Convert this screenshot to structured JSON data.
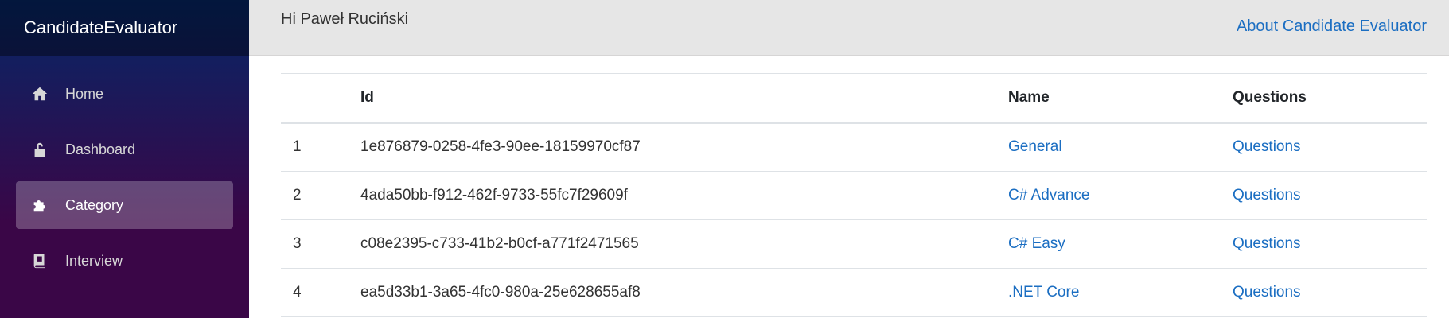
{
  "sidebar": {
    "brand": "CandidateEvaluator",
    "items": [
      {
        "label": "Home",
        "icon": "home-icon"
      },
      {
        "label": "Dashboard",
        "icon": "lock-open-icon"
      },
      {
        "label": "Category",
        "icon": "puzzle-icon"
      },
      {
        "label": "Interview",
        "icon": "book-icon"
      }
    ],
    "active": "Category"
  },
  "topbar": {
    "greeting": "Hi Paweł Ruciński",
    "about_link": "About Candidate Evaluator"
  },
  "table": {
    "headers": {
      "num": "",
      "id": "Id",
      "name": "Name",
      "questions": "Questions"
    },
    "rows": [
      {
        "num": "1",
        "id": "1e876879-0258-4fe3-90ee-18159970cf87",
        "name": "General",
        "questions": "Questions"
      },
      {
        "num": "2",
        "id": "4ada50bb-f912-462f-9733-55fc7f29609f",
        "name": "C# Advance",
        "questions": "Questions"
      },
      {
        "num": "3",
        "id": "c08e2395-c733-41b2-b0cf-a771f2471565",
        "name": "C# Easy",
        "questions": "Questions"
      },
      {
        "num": "4",
        "id": "ea5d33b1-3a65-4fc0-980a-25e628655af8",
        "name": ".NET Core",
        "questions": "Questions"
      }
    ]
  },
  "colors": {
    "link": "#1b6ec2",
    "sidebar_top": "#052767",
    "sidebar_bottom": "#3a0647",
    "topbar": "#e6e6e6"
  }
}
